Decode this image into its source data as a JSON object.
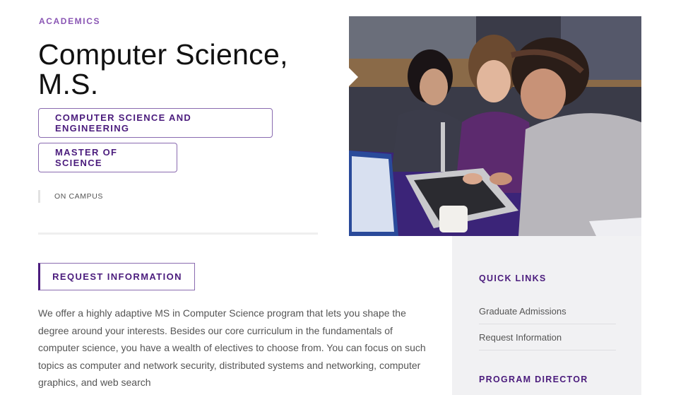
{
  "eyebrow": "ACADEMICS",
  "title": "Computer Science, M.S.",
  "tags": [
    "COMPUTER SCIENCE AND ENGINEERING",
    "MASTER OF SCIENCE"
  ],
  "delivery": "ON CAMPUS",
  "request_button": "REQUEST INFORMATION",
  "description": "We offer a highly adaptive MS in Computer Science program that lets you shape the degree around your interests. Besides our core curriculum in the fundamentals of computer science, you have a wealth of electives to choose from. You can focus on such topics as computer and network security, distributed systems and networking, computer graphics, and web search",
  "sidebar": {
    "quick_links_heading": "QUICK LINKS",
    "links": [
      "Graduate Admissions",
      "Request Information"
    ],
    "program_director_heading": "PROGRAM DIRECTOR"
  },
  "colors": {
    "brand_purple": "#4b1c7d",
    "accent_purple": "#8a56b4",
    "sidebar_bg": "#f1f1f3"
  }
}
